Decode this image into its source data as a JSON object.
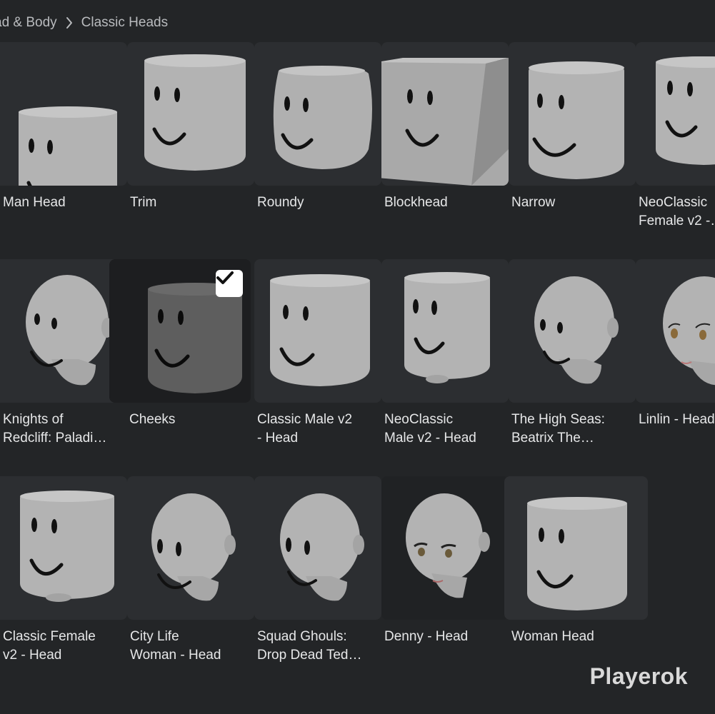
{
  "breadcrumb": {
    "parent": "ad & Body",
    "current": "Classic Heads"
  },
  "items": [
    {
      "label": "Man Head",
      "icon": "classic-head-icon"
    },
    {
      "label": "Trim",
      "icon": "classic-head-icon"
    },
    {
      "label": "Roundy",
      "icon": "round-head-icon"
    },
    {
      "label": "Blockhead",
      "icon": "block-head-icon"
    },
    {
      "label": "Narrow",
      "icon": "classic-head-icon"
    },
    {
      "label": "NeoClassic\nFemale v2 -…",
      "icon": "classic-head-icon"
    },
    {
      "label": "Knights of\nRedcliff: Paladi…",
      "icon": "realistic-head-icon"
    },
    {
      "label": "Cheeks",
      "icon": "classic-head-icon",
      "selected": true
    },
    {
      "label": "Classic Male v2\n- Head",
      "icon": "classic-head-icon"
    },
    {
      "label": "NeoClassic\nMale v2 - Head",
      "icon": "classic-head-icon"
    },
    {
      "label": "The High Seas:\nBeatrix The…",
      "icon": "realistic-head-icon"
    },
    {
      "label": "Linlin - Head",
      "icon": "anime-head-icon"
    },
    {
      "label": "Classic Female\nv2 - Head",
      "icon": "classic-head-icon"
    },
    {
      "label": "City Life\nWoman - Head",
      "icon": "realistic-head-icon"
    },
    {
      "label": "Squad Ghouls:\nDrop Dead Ted…",
      "icon": "realistic-head-icon"
    },
    {
      "label": "Denny - Head",
      "icon": "anime-head-icon"
    },
    {
      "label": "Woman Head",
      "icon": "classic-head-icon"
    }
  ],
  "watermark": "Playerok",
  "colors": {
    "background": "#232527",
    "tile": "#2c2e31",
    "selected_tile": "#1d1e20",
    "text": "#e6e7e8",
    "muted_text": "#b9bbbe"
  },
  "selected_item": "Cheeks"
}
